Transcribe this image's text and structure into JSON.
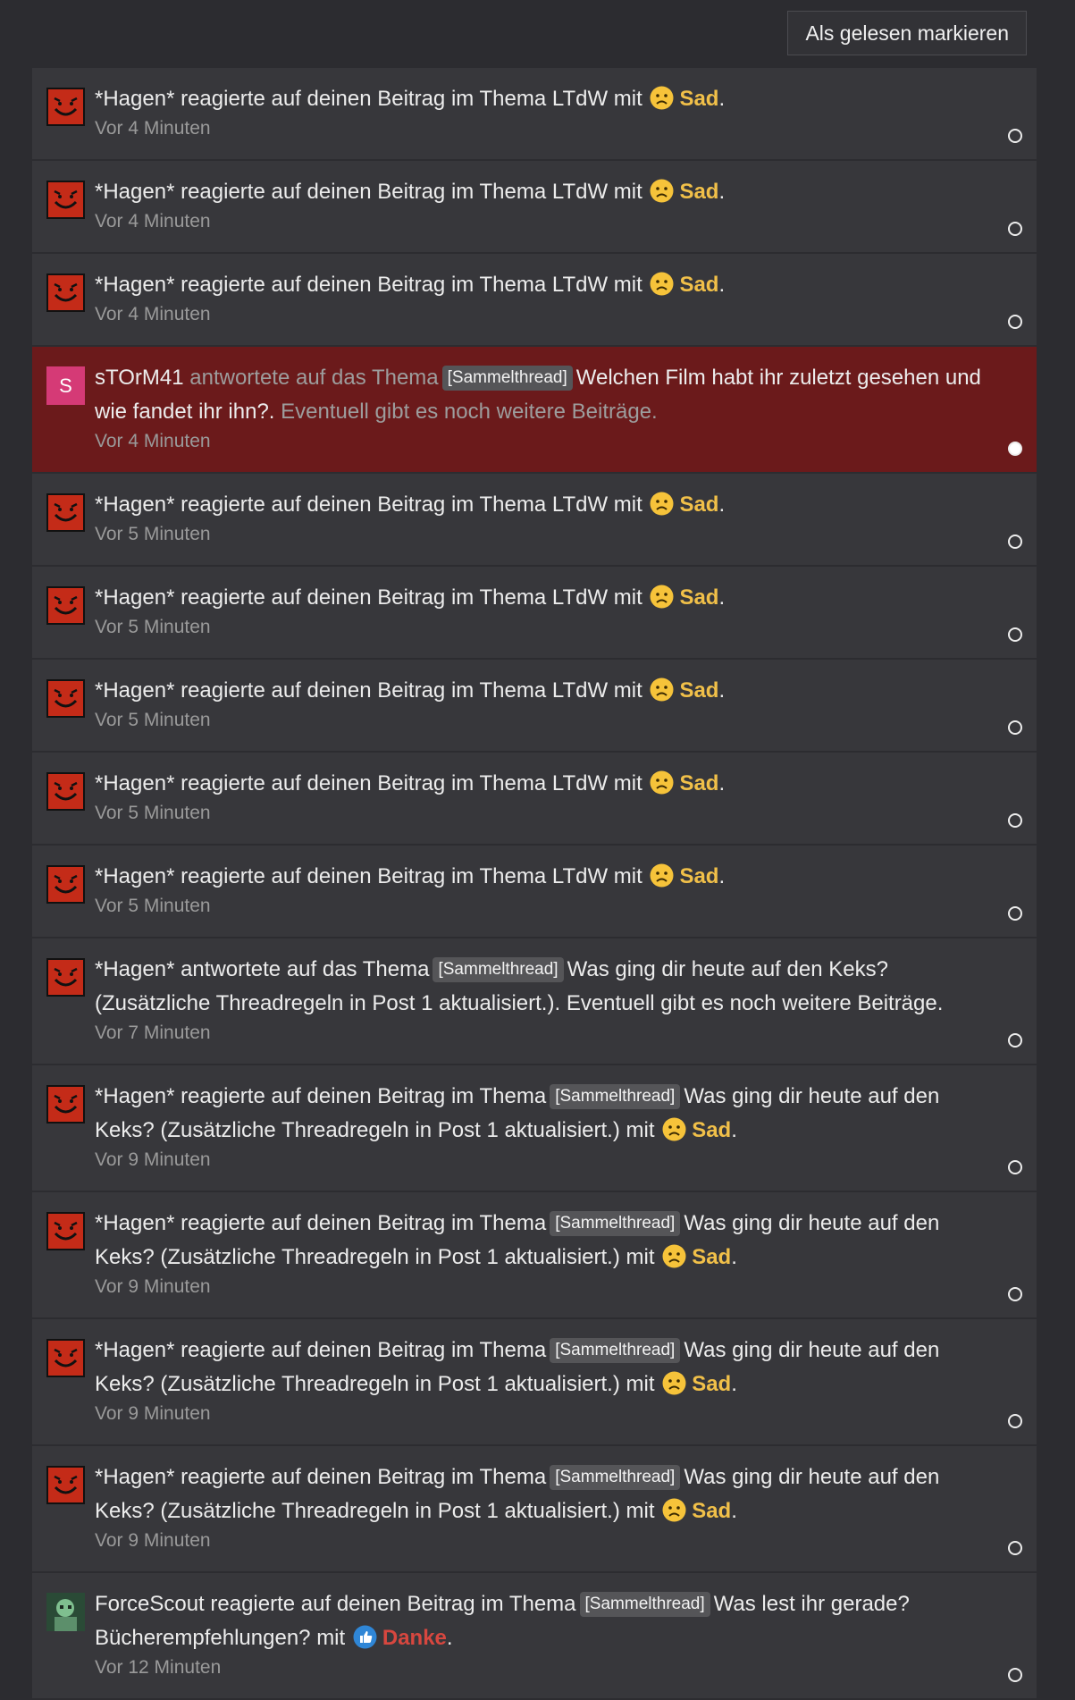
{
  "header": {
    "mark_all_read_label": "Als gelesen markieren"
  },
  "colors": {
    "reaction_sad": "#f1c049",
    "reaction_thanks": "#d7473f",
    "unread_bg": "#6b1a1b"
  },
  "notifications": [
    {
      "user": "*Hagen*",
      "action": "reagierte auf deinen Beitrag im Thema",
      "topic": "LTdW",
      "prefix": "",
      "mit": "mit",
      "reaction": "Sad",
      "time": "Vor 4 Minuten"
    },
    {
      "user": "*Hagen*",
      "action": "reagierte auf deinen Beitrag im Thema",
      "topic": "LTdW",
      "prefix": "",
      "mit": "mit",
      "reaction": "Sad",
      "time": "Vor 4 Minuten"
    },
    {
      "user": "*Hagen*",
      "action": "reagierte auf deinen Beitrag im Thema",
      "topic": "LTdW",
      "prefix": "",
      "mit": "mit",
      "reaction": "Sad",
      "time": "Vor 4 Minuten"
    },
    {
      "avatar_letter": "S",
      "user": "sTOrM41",
      "action": "antwortete auf das Thema",
      "prefix": "[Sammelthread]",
      "topic": "Welchen Film habt ihr zuletzt gesehen und wie fandet ihr ihn?",
      "more": "Eventuell gibt es noch weitere Beiträge.",
      "time": "Vor 4 Minuten"
    },
    {
      "user": "*Hagen*",
      "action": "reagierte auf deinen Beitrag im Thema",
      "topic": "LTdW",
      "prefix": "",
      "mit": "mit",
      "reaction": "Sad",
      "time": "Vor 5 Minuten"
    },
    {
      "user": "*Hagen*",
      "action": "reagierte auf deinen Beitrag im Thema",
      "topic": "LTdW",
      "prefix": "",
      "mit": "mit",
      "reaction": "Sad",
      "time": "Vor 5 Minuten"
    },
    {
      "user": "*Hagen*",
      "action": "reagierte auf deinen Beitrag im Thema",
      "topic": "LTdW",
      "prefix": "",
      "mit": "mit",
      "reaction": "Sad",
      "time": "Vor 5 Minuten"
    },
    {
      "user": "*Hagen*",
      "action": "reagierte auf deinen Beitrag im Thema",
      "topic": "LTdW",
      "prefix": "",
      "mit": "mit",
      "reaction": "Sad",
      "time": "Vor 5 Minuten"
    },
    {
      "user": "*Hagen*",
      "action": "reagierte auf deinen Beitrag im Thema",
      "topic": "LTdW",
      "prefix": "",
      "mit": "mit",
      "reaction": "Sad",
      "time": "Vor 5 Minuten"
    },
    {
      "user": "*Hagen*",
      "action": "antwortete auf das Thema",
      "prefix": "[Sammelthread]",
      "topic": "Was ging dir heute auf den Keks? (Zusätzliche Threadregeln in Post 1 aktualisiert.)",
      "more": "Eventuell gibt es noch weitere Beiträge.",
      "time": "Vor 7 Minuten"
    },
    {
      "user": "*Hagen*",
      "action": "reagierte auf deinen Beitrag im Thema",
      "prefix": "[Sammelthread]",
      "topic": "Was ging dir heute auf den Keks? (Zusätzliche Threadregeln in Post 1 aktualisiert.)",
      "mit": "mit",
      "reaction": "Sad",
      "time": "Vor 9 Minuten"
    },
    {
      "user": "*Hagen*",
      "action": "reagierte auf deinen Beitrag im Thema",
      "prefix": "[Sammelthread]",
      "topic": "Was ging dir heute auf den Keks? (Zusätzliche Threadregeln in Post 1 aktualisiert.)",
      "mit": "mit",
      "reaction": "Sad",
      "time": "Vor 9 Minuten"
    },
    {
      "user": "*Hagen*",
      "action": "reagierte auf deinen Beitrag im Thema",
      "prefix": "[Sammelthread]",
      "topic": "Was ging dir heute auf den Keks? (Zusätzliche Threadregeln in Post 1 aktualisiert.)",
      "mit": "mit",
      "reaction": "Sad",
      "time": "Vor 9 Minuten"
    },
    {
      "user": "*Hagen*",
      "action": "reagierte auf deinen Beitrag im Thema",
      "prefix": "[Sammelthread]",
      "topic": "Was ging dir heute auf den Keks? (Zusätzliche Threadregeln in Post 1 aktualisiert.)",
      "mit": "mit",
      "reaction": "Sad",
      "time": "Vor 9 Minuten"
    },
    {
      "user": "ForceScout",
      "action": "reagierte auf deinen Beitrag im Thema",
      "prefix": "[Sammelthread]",
      "topic": "Was lest ihr gerade? Bücherempfehlungen?",
      "mit": "mit",
      "reaction": "Danke",
      "time": "Vor 12 Minuten"
    }
  ]
}
